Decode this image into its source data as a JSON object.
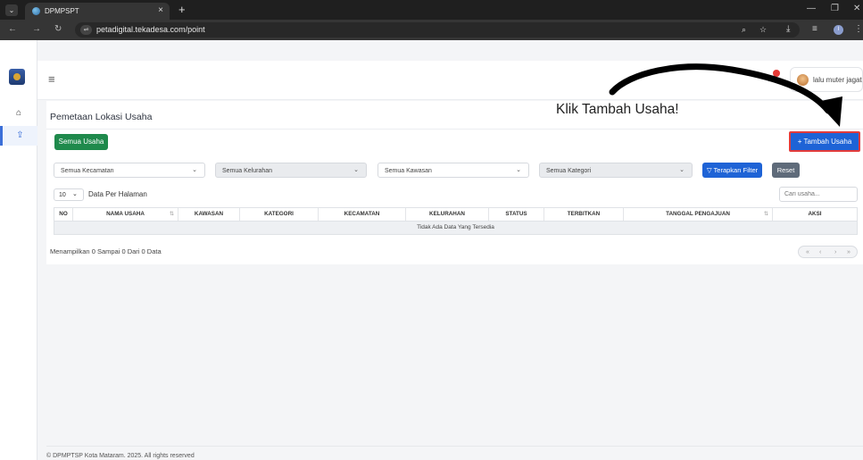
{
  "browser": {
    "tab_title": "DPMPSPT",
    "tab_close": "×",
    "new_tab": "+",
    "url": "petadigital.tekadesa.com/point",
    "profile_initial": "I"
  },
  "header": {
    "user_name": "lalu muter jagat"
  },
  "page": {
    "title": "Pemetaan Lokasi Usaha",
    "btn_all": "Semua Usaha",
    "btn_add": "+ Tambah Usaha",
    "filters": {
      "kecamatan": "Semua Kecamatan",
      "kelurahan": "Semua Kelurahan",
      "kawasan": "Semua Kawasan",
      "kategori": "Semua Kategori",
      "apply": "Terapkan Filter",
      "reset": "Reset"
    },
    "per_page_value": "10",
    "per_page_label": "Data Per Halaman",
    "search_placeholder": "Cari usaha...",
    "table": {
      "columns": [
        "NO",
        "NAMA USAHA",
        "KAWASAN",
        "KATEGORI",
        "KECAMATAN",
        "KELURAHAN",
        "STATUS",
        "TERBITKAN",
        "TANGGAL PENGAJUAN",
        "AKSI"
      ],
      "empty_message": "Tidak Ada Data Yang Tersedia"
    },
    "summary": "Menampilkan 0 Sampai 0 Dari 0 Data",
    "footer": "© DPMPTSP Kota Mataram. 2025. All rights reserved"
  },
  "annotation": {
    "text": "Klik Tambah Usaha!"
  },
  "colors": {
    "green": "#1f8a4c",
    "blue": "#1e63d6",
    "highlight_border": "#e23b3b",
    "reset_grey": "#5f6b7a"
  }
}
